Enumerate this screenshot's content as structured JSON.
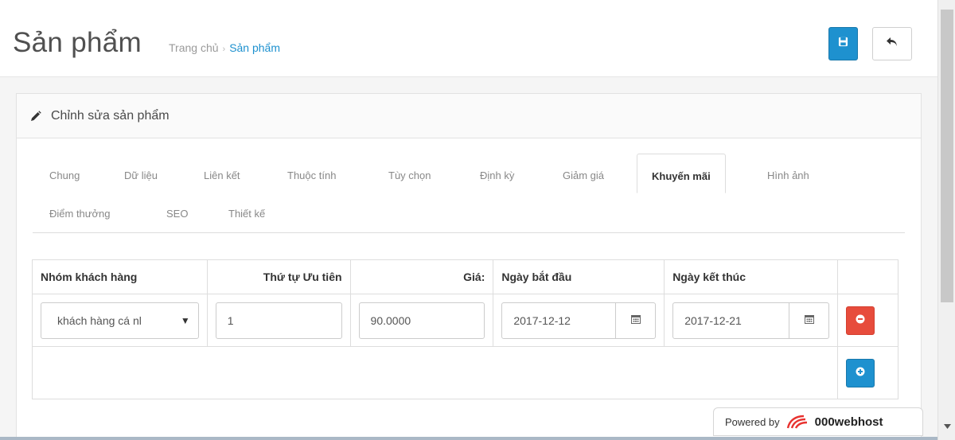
{
  "header": {
    "title": "Sản phẩm",
    "breadcrumb": {
      "home": "Trang chủ",
      "separator": "›",
      "current": "Sản phẩm"
    },
    "save_icon": "save-icon",
    "back_icon": "reply-icon"
  },
  "panel": {
    "heading": "Chỉnh sửa sản phẩm",
    "heading_icon": "pencil-icon"
  },
  "tabs": [
    {
      "label": "Chung",
      "active": false
    },
    {
      "label": "Dữ liệu",
      "active": false
    },
    {
      "label": "Liên kết",
      "active": false
    },
    {
      "label": "Thuộc tính",
      "active": false
    },
    {
      "label": "Tùy chọn",
      "active": false
    },
    {
      "label": "Định kỳ",
      "active": false
    },
    {
      "label": "Giảm giá",
      "active": false
    },
    {
      "label": "Khuyến mãi",
      "active": true
    },
    {
      "label": "Hình ảnh",
      "active": false
    },
    {
      "label": "Điểm thưởng",
      "active": false
    },
    {
      "label": "SEO",
      "active": false
    },
    {
      "label": "Thiết kế",
      "active": false
    }
  ],
  "table": {
    "headers": {
      "customer_group": "Nhóm khách hàng",
      "priority": "Thứ tự Ưu tiên",
      "price": "Giá:",
      "date_start": "Ngày bắt đầu",
      "date_end": "Ngày kết thúc"
    },
    "row": {
      "customer_group": "khách hàng cá nl",
      "priority": "1",
      "price": "90.0000",
      "date_start": "2017-12-12",
      "date_end": "2017-12-21"
    }
  },
  "powered_by": {
    "label": "Powered by",
    "brand": "000webhost"
  },
  "colors": {
    "primary": "#1e91cf",
    "danger": "#e74c3c",
    "active_tab_text": "#333333"
  }
}
